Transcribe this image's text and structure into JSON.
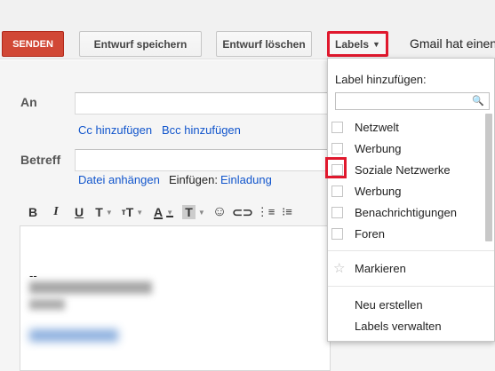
{
  "toolbar": {
    "send_label": "SENDEN",
    "save_draft_label": "Entwurf speichern",
    "discard_draft_label": "Entwurf löschen",
    "labels_label": "Labels",
    "gmail_text": "Gmail hat einen"
  },
  "compose": {
    "to_label": "An",
    "cc_link": "Cc hinzufügen",
    "bcc_link": "Bcc hinzufügen",
    "subject_label": "Betreff",
    "attach_link": "Datei anhängen",
    "insert_label": "Einfügen:",
    "invitation_link": "Einladung",
    "signature_dash": "--"
  },
  "labels_menu": {
    "heading": "Label hinzufügen:",
    "search_placeholder": "",
    "items": [
      {
        "label": "Netzwelt"
      },
      {
        "label": "Werbung"
      },
      {
        "label": "Soziale Netzwerke"
      },
      {
        "label": "Werbung"
      },
      {
        "label": "Benachrichtigungen"
      },
      {
        "label": "Foren"
      }
    ],
    "star_label": "Markieren",
    "create_label": "Neu erstellen",
    "manage_label": "Labels verwalten"
  },
  "colors": {
    "send_button": "#d14836",
    "highlight": "#e0182d",
    "link": "#1155cc"
  }
}
